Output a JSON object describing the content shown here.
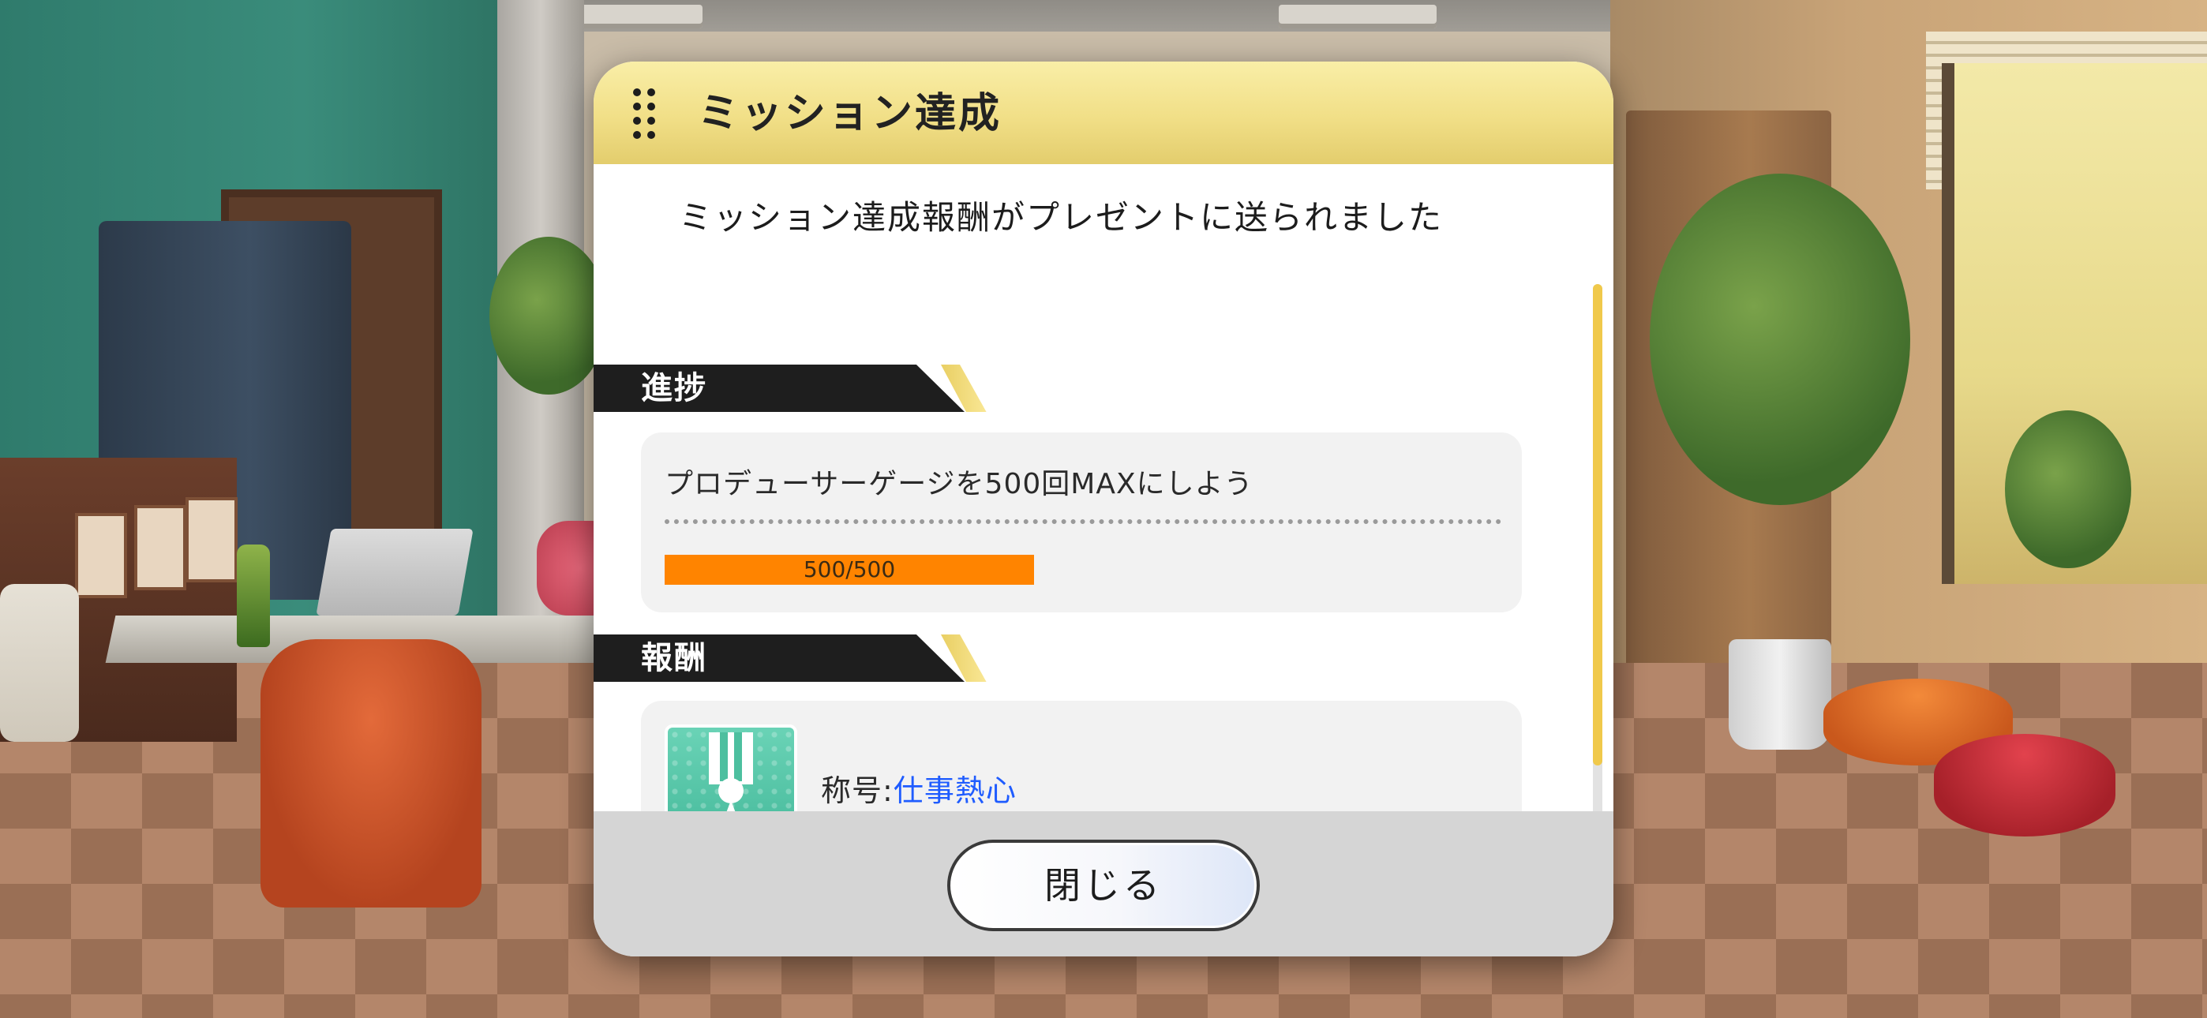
{
  "dialog": {
    "title": "ミッション達成",
    "notice": "ミッション達成報酬がプレゼントに送られました"
  },
  "progress_section": {
    "label": "進捗",
    "mission_text": "プロデューサーゲージを500回MAXにしよう",
    "progress_text": "500/500",
    "progress_value": 500,
    "progress_max": 500
  },
  "reward_section": {
    "label": "報酬",
    "reward_prefix": "称号:",
    "reward_name": "仕事熱心",
    "reward_icon": "medal-star-icon"
  },
  "footer": {
    "close_label": "閉じる"
  },
  "colors": {
    "header_gold": "#f1df87",
    "progress_orange": "#ff8400",
    "reward_link_blue": "#1f5cff",
    "scrollbar_gold": "#f0c94b"
  }
}
